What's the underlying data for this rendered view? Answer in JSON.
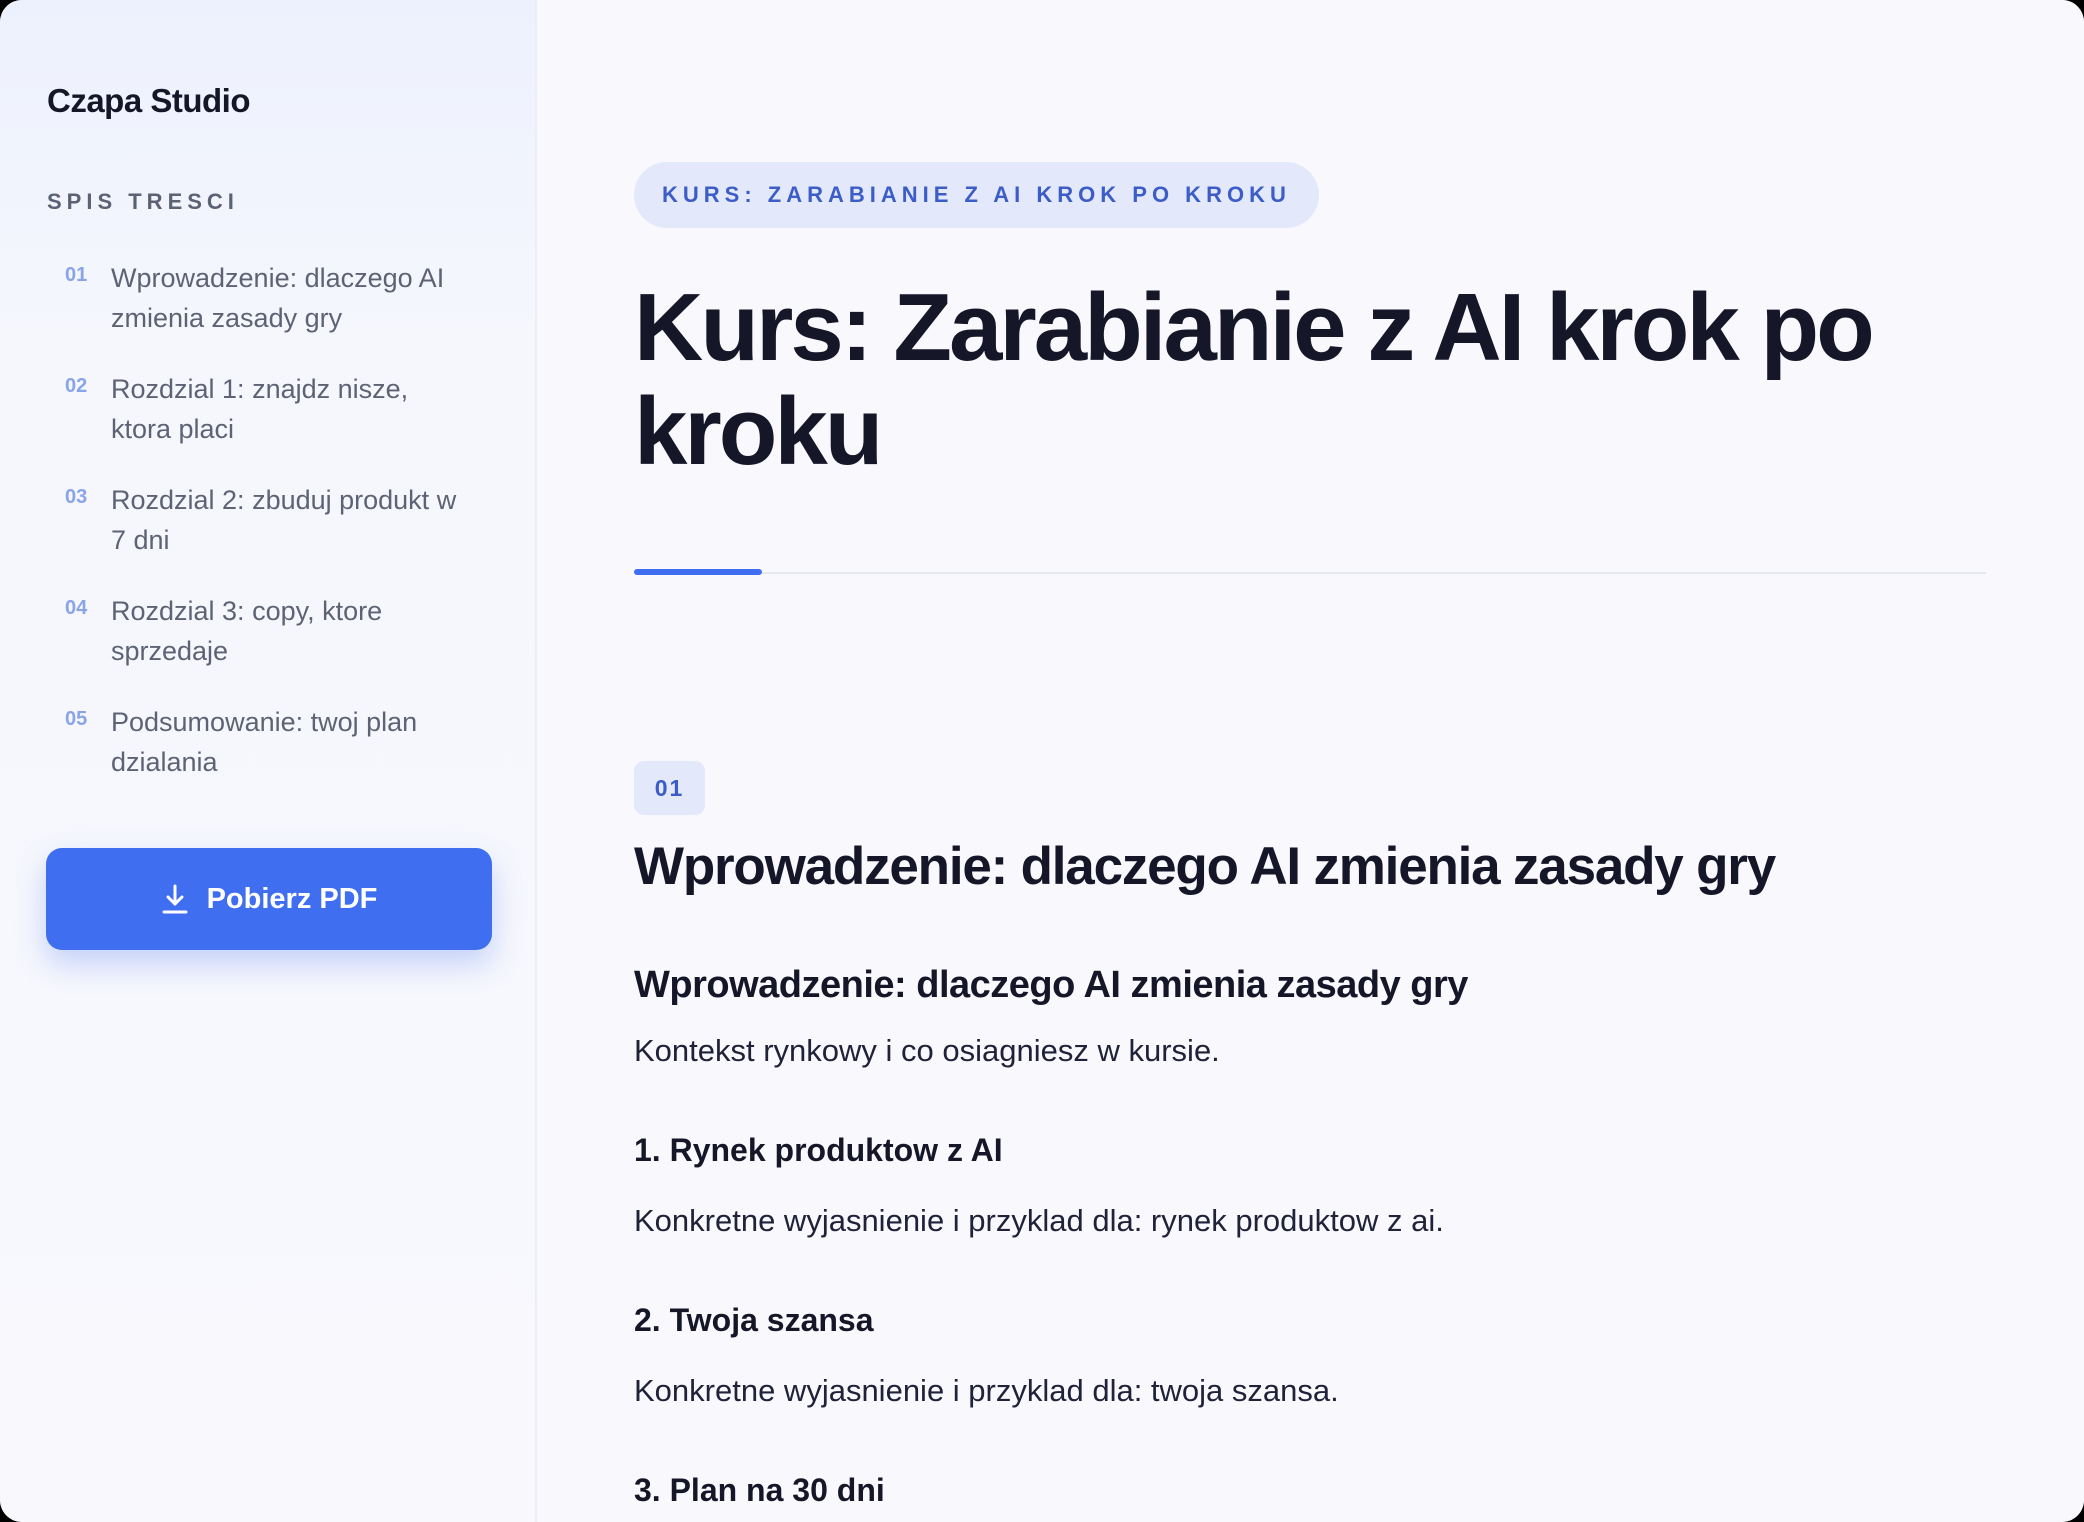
{
  "sidebar": {
    "brand": "Czapa Studio",
    "toc_heading": "SPIS TRESCI",
    "toc": [
      {
        "num": "01",
        "label": "Wprowadzenie: dlaczego AI zmienia zasady gry"
      },
      {
        "num": "02",
        "label": "Rozdzial 1: znajdz nisze, ktora placi"
      },
      {
        "num": "03",
        "label": "Rozdzial 2: zbuduj produkt w 7 dni"
      },
      {
        "num": "04",
        "label": "Rozdzial 3: copy, ktore sprzedaje"
      },
      {
        "num": "05",
        "label": "Podsumowanie: twoj plan dzialania"
      }
    ],
    "download_button": {
      "label": "Pobierz PDF",
      "icon": "download-icon"
    }
  },
  "main": {
    "kicker": "KURS: ZARABIANIE Z AI KROK PO KROKU",
    "title": "Kurs: Zarabianie z AI krok po kroku",
    "section": {
      "num": "01",
      "title": "Wprowadzenie: dlaczego AI zmienia zasady gry",
      "subtitle": "Wprowadzenie: dlaczego AI zmienia zasady gry",
      "lead": "Kontekst rynkowy i co osiagniesz w kursie.",
      "points": [
        {
          "heading": "1. Rynek produktow z AI",
          "body": "Konkretne wyjasnienie i przyklad dla: rynek produktow z ai."
        },
        {
          "heading": "2. Twoja szansa",
          "body": "Konkretne wyjasnienie i przyklad dla: twoja szansa."
        },
        {
          "heading": "3. Plan na 30 dni",
          "body": ""
        }
      ]
    }
  },
  "colors": {
    "accent": "#3f6ff0",
    "badge_bg": "#e3e9fb",
    "badge_text": "#3c5dc8",
    "heading": "#151729",
    "muted": "#5d6375"
  }
}
